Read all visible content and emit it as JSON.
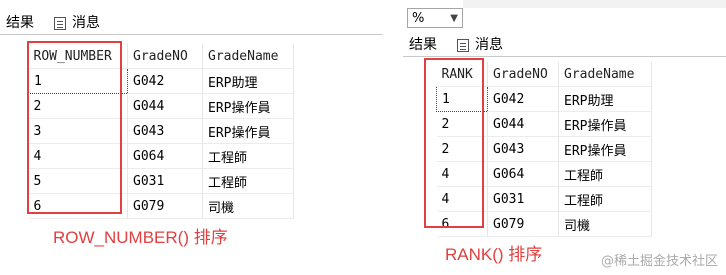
{
  "left": {
    "tabs": {
      "results": "结果",
      "messages": "消息"
    },
    "columns": [
      "ROW_NUMBER",
      "GradeNO",
      "GradeName"
    ],
    "rows": [
      [
        "1",
        "G042",
        "ERP助理"
      ],
      [
        "2",
        "G044",
        "ERP操作員"
      ],
      [
        "3",
        "G043",
        "ERP操作員"
      ],
      [
        "4",
        "G064",
        "工程師"
      ],
      [
        "5",
        "G031",
        "工程師"
      ],
      [
        "6",
        "G079",
        "司機"
      ]
    ],
    "caption": "ROW_NUMBER() 排序"
  },
  "right": {
    "zoom": "%",
    "tabs": {
      "results": "结果",
      "messages": "消息"
    },
    "columns": [
      "RANK",
      "GradeNO",
      "GradeName"
    ],
    "rows": [
      [
        "1",
        "G042",
        "ERP助理"
      ],
      [
        "2",
        "G044",
        "ERP操作員"
      ],
      [
        "2",
        "G043",
        "ERP操作員"
      ],
      [
        "4",
        "G064",
        "工程師"
      ],
      [
        "4",
        "G031",
        "工程師"
      ],
      [
        "6",
        "G079",
        "司機"
      ]
    ],
    "caption": "RANK() 排序"
  },
  "watermark": "@稀土掘金技术社区",
  "colors": {
    "annotation": "#e0403f"
  }
}
